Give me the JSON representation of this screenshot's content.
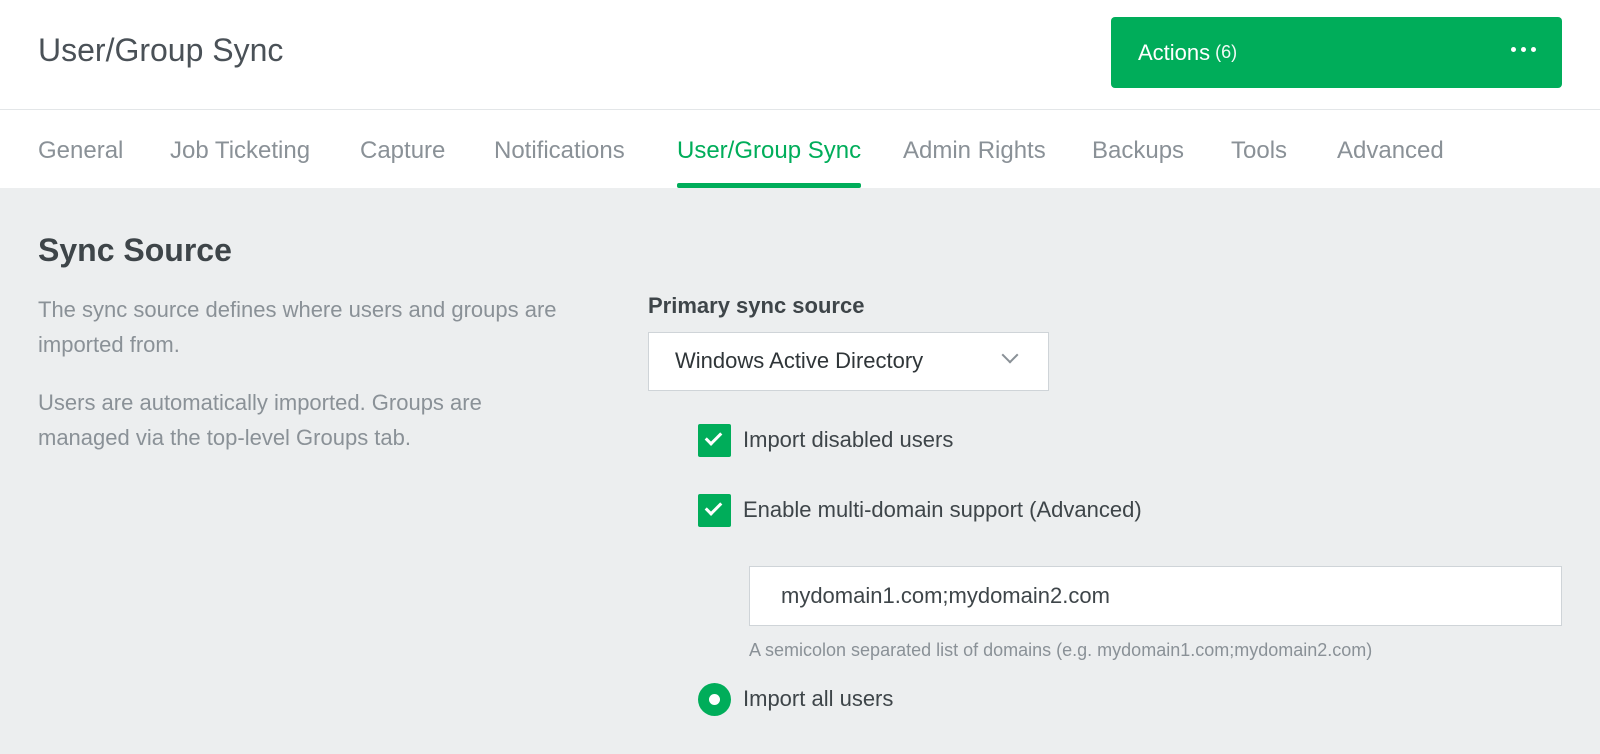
{
  "header": {
    "title": "User/Group Sync",
    "actions": {
      "label": "Actions",
      "count": "(6)"
    }
  },
  "tabs": [
    {
      "label": "General",
      "active": false
    },
    {
      "label": "Job Ticketing",
      "active": false
    },
    {
      "label": "Capture",
      "active": false
    },
    {
      "label": "Notifications",
      "active": false
    },
    {
      "label": "User/Group Sync",
      "active": true
    },
    {
      "label": "Admin Rights",
      "active": false
    },
    {
      "label": "Backups",
      "active": false
    },
    {
      "label": "Tools",
      "active": false
    },
    {
      "label": "Advanced",
      "active": false
    }
  ],
  "section": {
    "title": "Sync Source",
    "description_1": "The sync source defines where users and groups are imported from.",
    "description_2": "Users are automatically imported. Groups are managed via the top-level Groups tab."
  },
  "primary_sync": {
    "label": "Primary sync source",
    "selected": "Windows Active Directory"
  },
  "options": {
    "import_disabled_users": {
      "label": "Import disabled users",
      "checked": true
    },
    "multi_domain": {
      "label": "Enable multi-domain support (Advanced)",
      "checked": true
    },
    "domains_value": "mydomain1.com;mydomain2.com",
    "domains_hint": "A semicolon separated list of domains (e.g. mydomain1.com;mydomain2.com)",
    "import_all_users": {
      "label": "Import all users",
      "selected": true
    }
  },
  "colors": {
    "accent": "#00ad5a",
    "content_bg": "#eceeef",
    "muted_text": "#8a9197"
  },
  "icons": {
    "more": "more-horizontal-icon",
    "dropdown": "chevron-down-icon",
    "check": "check-icon",
    "radio": "radio-selected-icon"
  }
}
